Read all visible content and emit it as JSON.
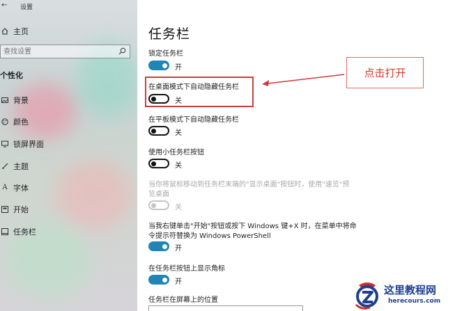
{
  "window": {
    "title": "设置",
    "back_icon": "back-arrow-icon"
  },
  "sidebar": {
    "home_label": "主页",
    "search": {
      "placeholder": "查找设置"
    },
    "section": "个性化",
    "items": [
      {
        "label": "背景",
        "icon": "image-icon"
      },
      {
        "label": "颜色",
        "icon": "palette-icon"
      },
      {
        "label": "锁屏界面",
        "icon": "monitor-icon"
      },
      {
        "label": "主题",
        "icon": "brush-icon"
      },
      {
        "label": "字体",
        "icon": "font-icon"
      },
      {
        "label": "开始",
        "icon": "start-icon"
      },
      {
        "label": "任务栏",
        "icon": "taskbar-icon"
      }
    ]
  },
  "main": {
    "title": "任务栏",
    "settings": [
      {
        "label": "锁定任务栏",
        "state": "开",
        "on": true
      },
      {
        "label": "在桌面模式下自动隐藏任务栏",
        "state": "关",
        "on": false
      },
      {
        "label": "在平板模式下自动隐藏任务栏",
        "state": "关",
        "on": false
      },
      {
        "label": "使用小任务栏按钮",
        "state": "关",
        "on": false
      },
      {
        "label_line1": "当你将鼠标移动到任务栏末端的\"显示桌面\"按钮时，使用\"速览\"预",
        "label_line2": "览桌面",
        "state": "关",
        "on": false,
        "disabled": true
      },
      {
        "label_line1": "当我右键单击\"开始\"按钮或按下 Windows 键+X 时，在菜单中将命",
        "label_line2": "令提示符替换为 Windows PowerShell",
        "state": "开",
        "on": true
      },
      {
        "label": "在任务栏按钮上显示角标",
        "state": "开",
        "on": true
      }
    ],
    "position_label": "任务栏在屏幕上的位置"
  },
  "annotation": {
    "callout": "点击打开",
    "color": "#d43b2e"
  },
  "watermark": {
    "title": "这里教程网",
    "url": "herecours.com"
  },
  "colors": {
    "accent": "#1f85b6",
    "annotation_red": "#d23a3a"
  }
}
